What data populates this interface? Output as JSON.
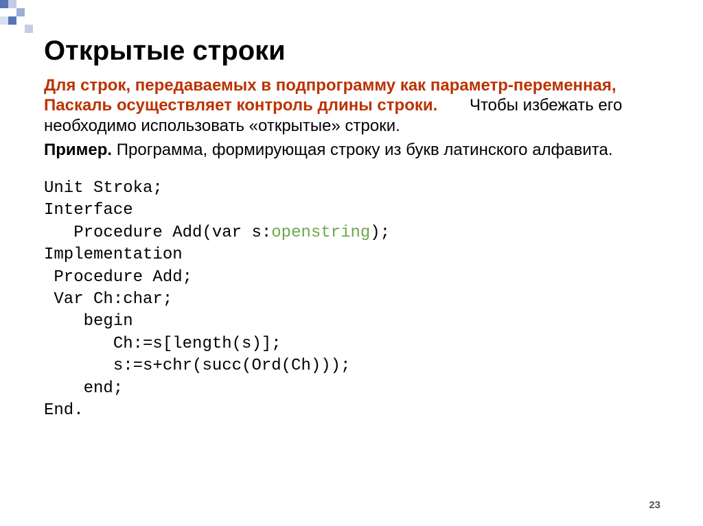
{
  "title": "Открытые строки",
  "para1": {
    "red_part": "Для строк, передаваемых в подпрограмму как параметр-переменная, Паскаль осуществляет контроль длины строки.",
    "plain_part": " Чтобы избежать его необходимо использовать «открытые» строки."
  },
  "para2": {
    "label": "Пример.",
    "text": "  Программа, формирующая строку из букв латинского алфавита."
  },
  "code": {
    "l1": "Unit Stroka;",
    "l2": "Interface",
    "l3a": "   Procedure Add(var s:",
    "l3_kw": "openstring",
    "l3b": ");",
    "l4": "Implementation",
    "l5": " Procedure Add;",
    "l6": " Var Ch:char;",
    "l7": "    begin",
    "l8": "       Ch:=s[length(s)];",
    "l9": "       s:=s+chr(succ(Ord(Ch)));",
    "l10": "    end;",
    "l11": "End."
  },
  "page_number": "23"
}
